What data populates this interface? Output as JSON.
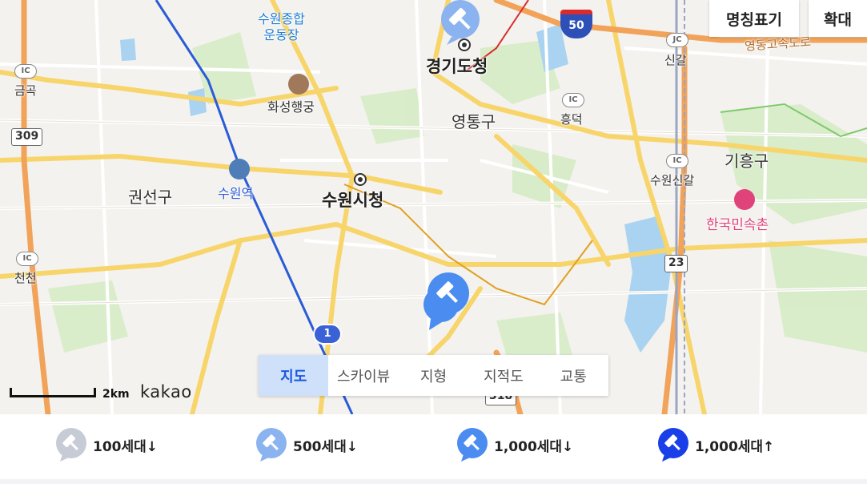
{
  "map": {
    "labels": {
      "suwon_stadium": "수원종합\n운동장",
      "gyeonggi_office": "경기도청",
      "hwaseong_palace": "화성행궁",
      "yeongtong": "영통구",
      "heungdeok": "흥덕",
      "singal": "신갈",
      "giheung": "기흥구",
      "suwon_singal": "수원신갈",
      "korean_folk_village": "한국민속촌",
      "gwonseon": "권선구",
      "suwon_station": "수원역",
      "suwon_cityhall": "수원시청",
      "geumgok": "금곡",
      "cheoncheon": "천천"
    },
    "ic_text": "IC",
    "jc_text": "JC",
    "routes": {
      "r309": "309",
      "r23": "23",
      "r1": "1",
      "r50": "50",
      "r318": "318"
    },
    "highway_label": "영동고속도로"
  },
  "controls": {
    "name_toggle": "명칭표기",
    "zoom": "확대"
  },
  "map_types": [
    {
      "label": "지도",
      "active": true
    },
    {
      "label": "스카이뷰",
      "active": false
    },
    {
      "label": "지형",
      "active": false
    },
    {
      "label": "지적도",
      "active": false
    },
    {
      "label": "교통",
      "active": false
    }
  ],
  "scale": {
    "label": "2km"
  },
  "attribution": "kakao",
  "legend": [
    {
      "label": "100세대↓",
      "color": "#c7cbd6"
    },
    {
      "label": "500세대↓",
      "color": "#8bb3f0"
    },
    {
      "label": "1,000세대↓",
      "color": "#4a8cf0"
    },
    {
      "label": "1,000세대↑",
      "color": "#1a3ee8"
    }
  ]
}
